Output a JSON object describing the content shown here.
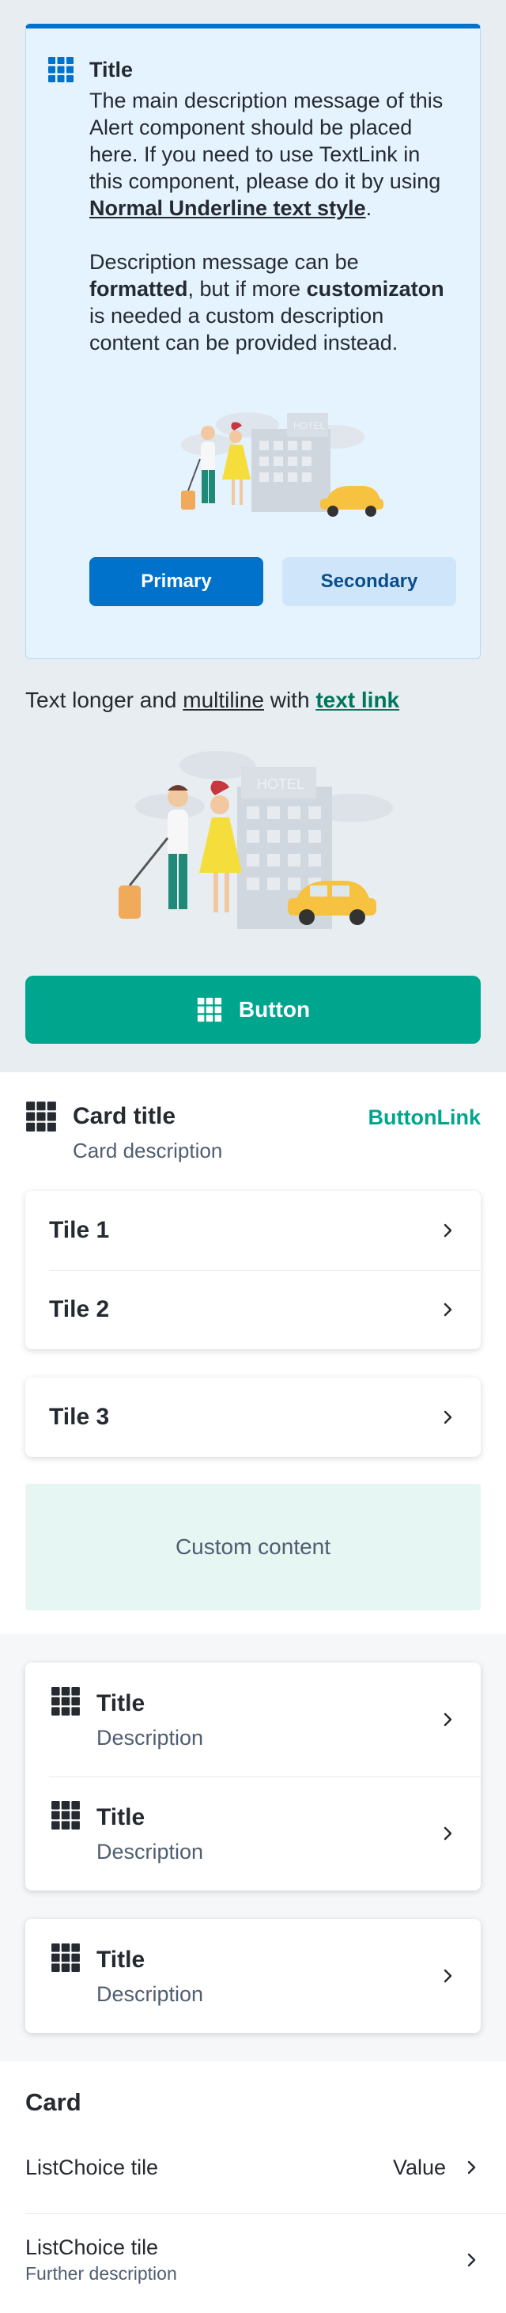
{
  "alert": {
    "title": "Title",
    "desc_p1_a": "The main description message of this Alert component should be placed here. If you need to use TextLink in this component, please do it by using ",
    "desc_p1_link": "Normal Underline text style",
    "desc_p1_b": ".",
    "desc_p2_a": "Description message can be ",
    "desc_p2_bold1": "formatted",
    "desc_p2_b": ", but if more ",
    "desc_p2_bold2": "customizaton",
    "desc_p2_c": " is needed a custom description content can be provided instead.",
    "primary_label": "Primary",
    "secondary_label": "Secondary",
    "illustration_sign": "HOTEL"
  },
  "text_line": {
    "a": "Text longer and ",
    "underline": "multiline",
    "b": " with ",
    "link": "text link"
  },
  "illustration": {
    "sign": "HOTEL"
  },
  "big_button": {
    "label": "Button"
  },
  "card": {
    "title": "Card title",
    "description": "Card description",
    "link": "ButtonLink",
    "tiles": [
      "Tile 1",
      "Tile 2"
    ],
    "tile3": "Tile 3",
    "custom_content": "Custom content"
  },
  "list_tiles": {
    "group": [
      {
        "title": "Title",
        "description": "Description"
      },
      {
        "title": "Title",
        "description": "Description"
      }
    ],
    "single": {
      "title": "Title",
      "description": "Description"
    }
  },
  "choice_card": {
    "title": "Card",
    "row1": {
      "label": "ListChoice tile",
      "value": "Value"
    },
    "row2": {
      "label": "ListChoice tile",
      "sub": "Further description"
    }
  },
  "colors": {
    "alert_blue": "#0172cb",
    "product_green": "#00a58e",
    "link_green": "#00765d"
  }
}
